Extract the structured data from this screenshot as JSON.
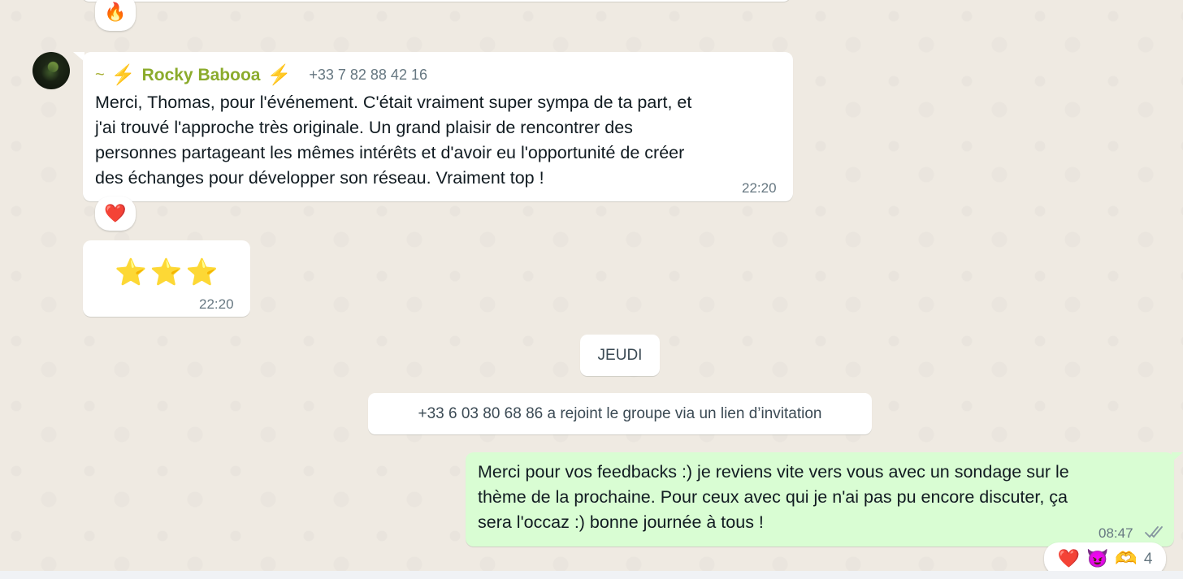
{
  "previous_message": {
    "reaction": "🔥"
  },
  "incoming_message": {
    "sender_prefix": "~",
    "bolt_left": "⚡",
    "sender_name": "Rocky Babooa",
    "bolt_right": "⚡",
    "sender_phone": "+33 7 82 88 42 16",
    "text": "Merci, Thomas, pour l'événement. C'était vraiment super sympa de ta part, et\nj'ai trouvé l'approche très originale. Un grand plaisir de rencontrer des\npersonnes partageant les mêmes intérêts et d'avoir eu l'opportunité de créer\ndes échanges pour développer son réseau. Vraiment top !",
    "time": "22:20",
    "reaction": "❤️"
  },
  "stars_message": {
    "content": "⭐⭐⭐",
    "time": "22:20"
  },
  "date_divider": "JEUDI",
  "system_notice": "+33 6 03 80 68 86 a rejoint le groupe via un lien d’invitation",
  "outgoing_message": {
    "text": "Merci pour vos feedbacks :) je reviens vite vers vous avec un sondage sur le\nthème de la prochaine. Pour ceux avec qui je n'ai pas pu encore discuter, ça\nsera l'occaz :) bonne journée à tous !",
    "time": "08:47",
    "status_icon": "double-check-icon",
    "reactions": [
      "❤️",
      "😈",
      "🫶"
    ],
    "reaction_count": "4"
  },
  "colors": {
    "chat_background": "#efeae2",
    "incoming_bubble": "#ffffff",
    "outgoing_bubble": "#d9fdd3",
    "sender_name": "#8bab2c",
    "meta_text": "#667781"
  }
}
